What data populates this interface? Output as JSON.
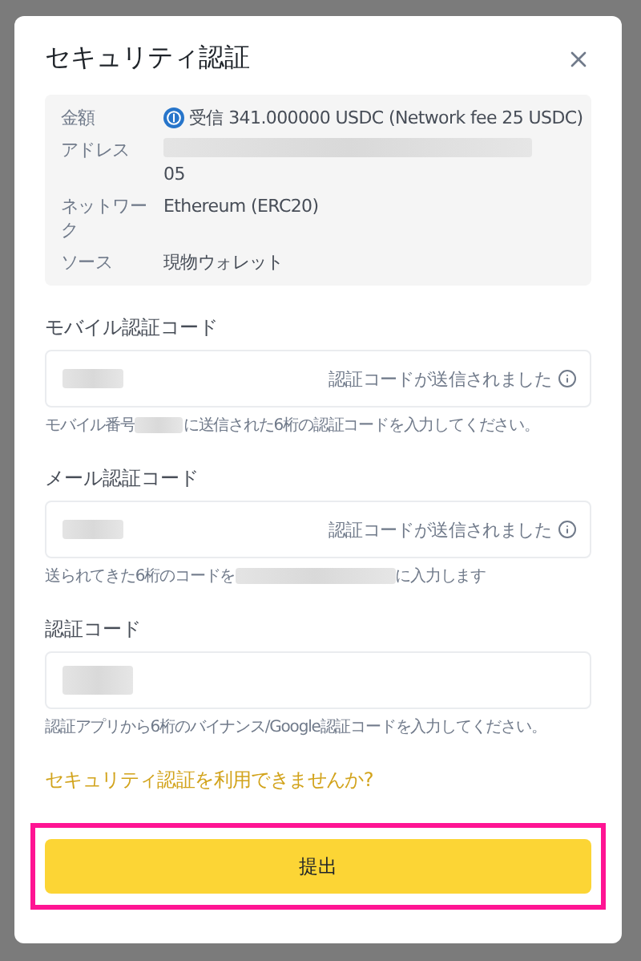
{
  "dialog": {
    "title": "セキュリティ認証",
    "details": [
      {
        "label": "金額",
        "value": "受信 341.000000 USDC (Network fee 25 USDC)",
        "kind": "amount"
      },
      {
        "label": "アドレス",
        "value": "05",
        "kind": "redacted"
      },
      {
        "label": "ネットワーク",
        "value": "Ethereum (ERC20)",
        "kind": "plain"
      },
      {
        "label": "ソース",
        "value": "現物ウォレット",
        "kind": "plain"
      }
    ],
    "fields": [
      {
        "label": "モバイル認証コード",
        "status": "認証コードが送信されました",
        "hint_parts": [
          "モバイル番号",
          "に送信された6桁の認証コードを入力してください。"
        ]
      },
      {
        "label": "メール認証コード",
        "status": "認証コードが送信されました",
        "hint_parts": [
          "送られてきた6桁のコードを",
          "に入力します"
        ]
      },
      {
        "label": "認証コード",
        "hint_parts": [
          "認証アプリから6桁のバイナンス/Google認証コードを入力してください。"
        ]
      }
    ],
    "link": "セキュリティ認証を利用できませんか?",
    "submit": {
      "label": "提出",
      "highlighted": true
    }
  }
}
